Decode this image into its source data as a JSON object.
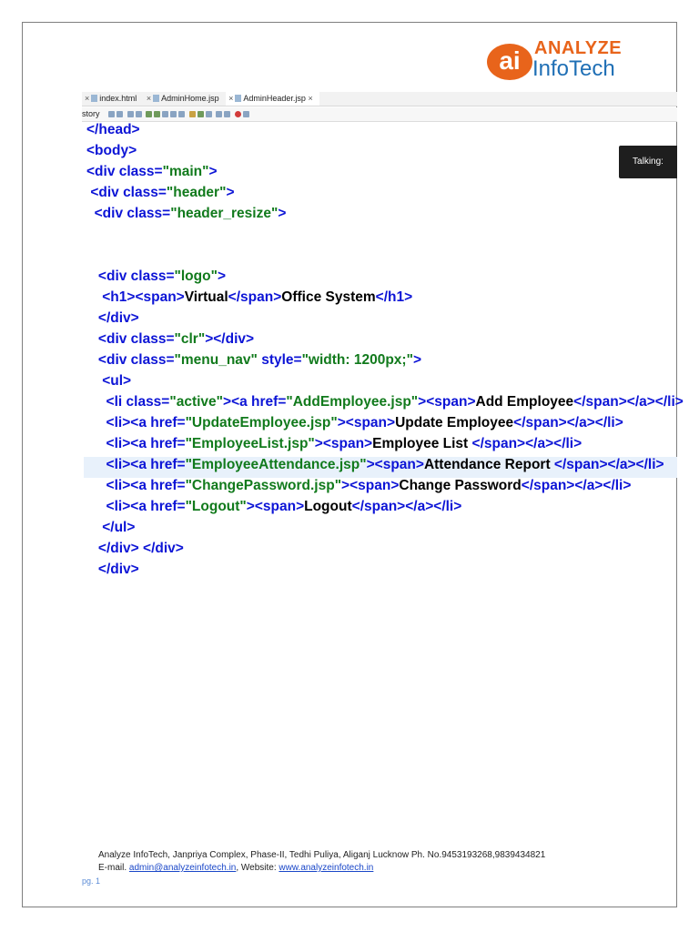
{
  "logo": {
    "mark": "ai",
    "top": "ANALYZE",
    "bottom": "InfoTech"
  },
  "tabs": [
    {
      "label": "index.html",
      "active": false
    },
    {
      "label": "AdminHome.jsp",
      "active": false
    },
    {
      "label": "AdminHeader.jsp",
      "active": true
    }
  ],
  "toolbar": {
    "label": "story"
  },
  "overlay": {
    "text": "Talking:"
  },
  "code_lines": [
    "</head>",
    "<body>",
    "<div class=\"main\">",
    " <div class=\"header\">",
    "  <div class=\"header_resize\">",
    "",
    "",
    "   <div class=\"logo\">",
    "    <h1><span>Virtual</span>Office System</h1>",
    "   </div>",
    "   <div class=\"clr\"></div>",
    "   <div class=\"menu_nav\" style=\"width: 1200px;\">",
    "    <ul>",
    "     <li class=\"active\"><a href=\"AddEmployee.jsp\"><span>Add Employee</span></a></li>",
    "     <li><a href=\"UpdateEmployee.jsp\"><span>Update Employee</span></a></li>",
    "     <li><a href=\"EmployeeList.jsp\"><span>Employee List </span></a></li>",
    "     <li><a href=\"EmployeeAttendance.jsp\"><span>Attendance Report </span></a></li>",
    "     <li><a href=\"ChangePassword.jsp\"><span>Change Password</span></a></li>",
    "     <li><a href=\"Logout\"><span>Logout</span></a></li>",
    "    </ul>",
    "   </div> </div>",
    "   </div>"
  ],
  "highlight_line": 16,
  "footer": {
    "address": "Analyze InfoTech, Janpriya Complex, Phase-II, Tedhi Puliya,  Aliganj Lucknow Ph. No.9453193268,9839434821",
    "email_label": "E-mail. ",
    "email": "admin@analyzeinfotech.in",
    "website_label": ", Website:  ",
    "website": "www.analyzeinfotech.in",
    "page": "pg. 1"
  },
  "colors": {
    "tag": "#0c14d6",
    "value": "#117a1c",
    "brand_orange": "#e8641b",
    "brand_blue": "#1f6fb5"
  }
}
